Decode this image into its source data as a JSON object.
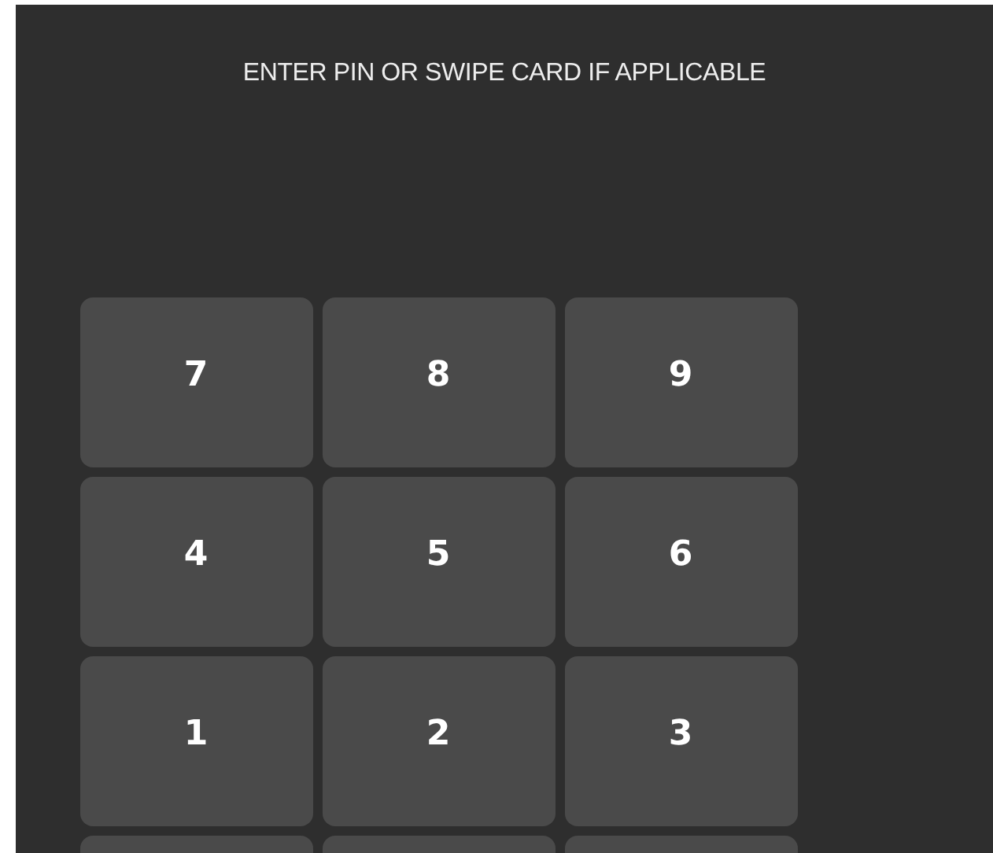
{
  "prompt": "ENTER PIN OR SWIPE CARD IF APPLICABLE",
  "keypad": {
    "rows": [
      {
        "keys": [
          "7",
          "8",
          "9"
        ]
      },
      {
        "keys": [
          "4",
          "5",
          "6"
        ]
      },
      {
        "keys": [
          "1",
          "2",
          "3"
        ]
      }
    ]
  }
}
